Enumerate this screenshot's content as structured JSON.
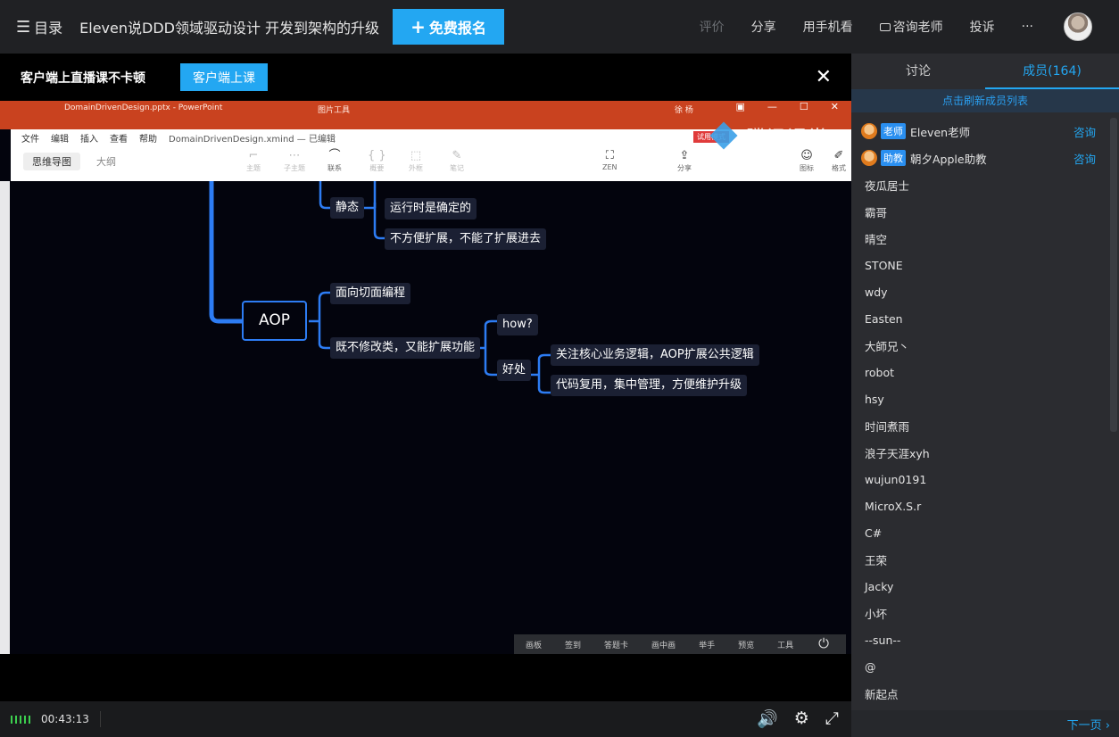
{
  "header": {
    "menu_label": "目录",
    "course_title": "Eleven说DDD领域驱动设计 开发到架构的升级",
    "signup_label": "免费报名",
    "actions": [
      "评价",
      "分享",
      "用手机看",
      "咨询老师",
      "投诉",
      "···"
    ]
  },
  "banner": {
    "text": "客户端上直播课不卡顿",
    "button": "客户端上课"
  },
  "screen": {
    "ppt_file": "DomainDrivenDesign.pptx - PowerPoint",
    "ppt_tool": "图片工具",
    "ppt_user": "徐 杨",
    "xmind_menu": [
      "文件",
      "编辑",
      "插入",
      "查看",
      "帮助"
    ],
    "xmind_doc": "DomainDrivenDesign.xmind — 已编辑",
    "xmind_tabs": [
      "思维导图",
      "大纲"
    ],
    "tools": [
      {
        "label": "主题",
        "glyph": "⌐"
      },
      {
        "label": "子主题",
        "glyph": "⋯"
      },
      {
        "label": "联系",
        "glyph": "⌒"
      },
      {
        "label": "概要",
        "glyph": "{ }"
      },
      {
        "label": "外框",
        "glyph": "⬚"
      },
      {
        "label": "笔记",
        "glyph": "✎"
      },
      {
        "label": "ZEN",
        "glyph": "⛶"
      },
      {
        "label": "分享",
        "glyph": "⇪"
      },
      {
        "label": "图标",
        "glyph": "☺"
      },
      {
        "label": "格式",
        "glyph": "✐"
      }
    ],
    "trial": "试用模式",
    "watermark": "腾讯课堂",
    "nodes": {
      "static": "静态",
      "runtime_fixed": "运行时是确定的",
      "hard_extend": "不方便扩展，不能了扩展进去",
      "aop": "AOP",
      "aspect": "面向切面编程",
      "no_modify": "既不修改类，又能扩展功能",
      "how": "how?",
      "benefit": "好处",
      "focus": "关注核心业务逻辑，AOP扩展公共逻辑",
      "reuse": "代码复用，集中管理，方便维护升级"
    },
    "controls": [
      "画板",
      "签到",
      "答题卡",
      "画中画",
      "举手",
      "预览",
      "工具"
    ]
  },
  "player": {
    "time": "00:43:13"
  },
  "side": {
    "tab_discuss": "讨论",
    "tab_members": "成员(164)",
    "refresh": "点击刷新成员列表",
    "consult": "咨询",
    "next": "下一页",
    "staff": [
      {
        "role": "老师",
        "name": "Eleven老师"
      },
      {
        "role": "助教",
        "name": "朝夕Apple助教"
      }
    ],
    "members": [
      "夜瓜居士",
      "霸哥",
      "晴空",
      "STONE",
      "wdy",
      "Easten",
      "大師兄丶",
      "robot",
      "hsy",
      "时间煮雨",
      "浪子天涯xyh",
      "wujun0191",
      "MicroX.S.r",
      "C#",
      "王荣",
      "Jacky",
      "小坏",
      "--sun--",
      "@",
      "新起点"
    ]
  }
}
